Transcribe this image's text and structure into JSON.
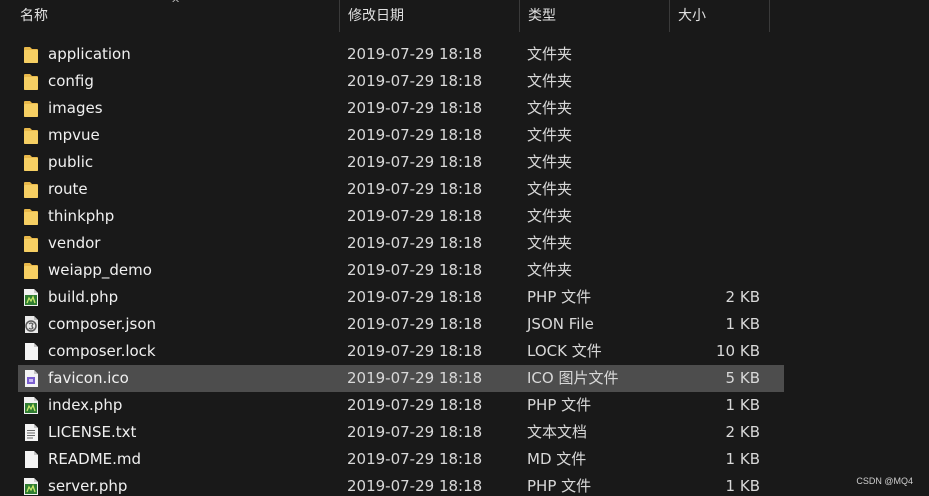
{
  "columns": {
    "name": "名称",
    "date": "修改日期",
    "type": "类型",
    "size": "大小"
  },
  "sort_indicator": "^",
  "files": [
    {
      "name": "application",
      "date": "2019-07-29 18:18",
      "type": "文件夹",
      "size": "",
      "icon": "folder-icon"
    },
    {
      "name": "config",
      "date": "2019-07-29 18:18",
      "type": "文件夹",
      "size": "",
      "icon": "folder-icon"
    },
    {
      "name": "images",
      "date": "2019-07-29 18:18",
      "type": "文件夹",
      "size": "",
      "icon": "folder-icon"
    },
    {
      "name": "mpvue",
      "date": "2019-07-29 18:18",
      "type": "文件夹",
      "size": "",
      "icon": "folder-icon"
    },
    {
      "name": "public",
      "date": "2019-07-29 18:18",
      "type": "文件夹",
      "size": "",
      "icon": "folder-icon"
    },
    {
      "name": "route",
      "date": "2019-07-29 18:18",
      "type": "文件夹",
      "size": "",
      "icon": "folder-icon"
    },
    {
      "name": "thinkphp",
      "date": "2019-07-29 18:18",
      "type": "文件夹",
      "size": "",
      "icon": "folder-icon"
    },
    {
      "name": "vendor",
      "date": "2019-07-29 18:18",
      "type": "文件夹",
      "size": "",
      "icon": "folder-icon"
    },
    {
      "name": "weiapp_demo",
      "date": "2019-07-29 18:18",
      "type": "文件夹",
      "size": "",
      "icon": "folder-icon"
    },
    {
      "name": "build.php",
      "date": "2019-07-29 18:18",
      "type": "PHP 文件",
      "size": "2 KB",
      "icon": "php-file-icon"
    },
    {
      "name": "composer.json",
      "date": "2019-07-29 18:18",
      "type": "JSON File",
      "size": "1 KB",
      "icon": "json-file-icon"
    },
    {
      "name": "composer.lock",
      "date": "2019-07-29 18:18",
      "type": "LOCK 文件",
      "size": "10 KB",
      "icon": "blank-file-icon"
    },
    {
      "name": "favicon.ico",
      "date": "2019-07-29 18:18",
      "type": "ICO 图片文件",
      "size": "5 KB",
      "icon": "image-file-icon",
      "selected": true
    },
    {
      "name": "index.php",
      "date": "2019-07-29 18:18",
      "type": "PHP 文件",
      "size": "1 KB",
      "icon": "php-file-icon"
    },
    {
      "name": "LICENSE.txt",
      "date": "2019-07-29 18:18",
      "type": "文本文档",
      "size": "2 KB",
      "icon": "text-file-icon"
    },
    {
      "name": "README.md",
      "date": "2019-07-29 18:18",
      "type": "MD 文件",
      "size": "1 KB",
      "icon": "blank-file-icon"
    },
    {
      "name": "server.php",
      "date": "2019-07-29 18:18",
      "type": "PHP 文件",
      "size": "1 KB",
      "icon": "php-file-icon"
    }
  ],
  "watermark": "CSDN @MQ4",
  "colors": {
    "background": "#191919",
    "selected_row": "#4d4d4d",
    "folder": "#f4c95a"
  }
}
